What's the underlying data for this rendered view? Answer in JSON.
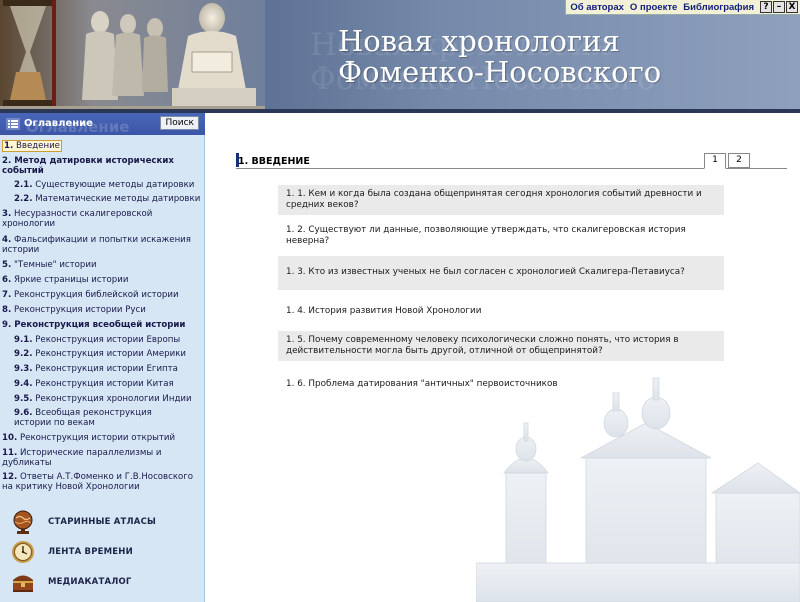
{
  "header": {
    "title_line1": "Новая хронология",
    "title_line2": "Фоменко-Носовского",
    "links": [
      "Об авторах",
      "О проекте",
      "Библиография"
    ],
    "window_buttons": [
      "?",
      "–",
      "X"
    ]
  },
  "sidebar": {
    "title": "Оглавление",
    "ghost_title": "Оглавление",
    "search_label": "Поиск",
    "toc": [
      {
        "num": "1.",
        "label": "Введение",
        "active": true
      },
      {
        "num": "2.",
        "label": "Метод датировки исторических событий",
        "bold": true
      },
      {
        "num": "2.1.",
        "label": "Существующие методы датировки",
        "sub": true
      },
      {
        "num": "2.2.",
        "label": "Математические методы датировки",
        "sub": true
      },
      {
        "num": "3.",
        "label": "Несуразности скалигеровской хронологии"
      },
      {
        "num": "4.",
        "label": "Фальсификации и попытки искажения истории"
      },
      {
        "num": "5.",
        "label": "\"Темные\" истории"
      },
      {
        "num": "6.",
        "label": "Яркие страницы истории"
      },
      {
        "num": "7.",
        "label": "Реконструкция библейской истории"
      },
      {
        "num": "8.",
        "label": "Реконструкция истории Руси"
      },
      {
        "num": "9.",
        "label": "Реконструкция всеобщей истории",
        "bold": true
      },
      {
        "num": "9.1.",
        "label": "Реконструкция истории Европы",
        "sub": true
      },
      {
        "num": "9.2.",
        "label": "Реконструкция истории Америки",
        "sub": true
      },
      {
        "num": "9.3.",
        "label": "Реконструкция истории Египта",
        "sub": true
      },
      {
        "num": "9.4.",
        "label": "Реконструкция истории Китая",
        "sub": true
      },
      {
        "num": "9.5.",
        "label": "Реконструкция хронологии Индии",
        "sub": true
      },
      {
        "num": "9.6.",
        "label": "Всеобщая реконструкция истории по векам",
        "sub": true
      },
      {
        "num": "10.",
        "label": "Реконструкция истории открытий"
      },
      {
        "num": "11.",
        "label": "Исторические параллелизмы и дубликаты"
      },
      {
        "num": "12.",
        "label": "Ответы А.Т.Фоменко и Г.В.Носовского на критику Новой Хронологии"
      }
    ],
    "bottom_links": [
      {
        "label": "СТАРИННЫЕ АТЛАСЫ",
        "icon": "globe-icon"
      },
      {
        "label": "ЛЕНТА ВРЕМЕНИ",
        "icon": "clock-icon"
      },
      {
        "label": "МЕДИАКАТАЛОГ",
        "icon": "chest-icon"
      }
    ]
  },
  "main": {
    "section_title": "1. ВВЕДЕНИЕ",
    "page_tabs": [
      "1",
      "2"
    ],
    "questions": [
      "1. 1. Кем и когда была создана общепринятая сегодня хронология событий древности и средних веков?",
      "1. 2. Существуют ли данные, позволяющие утверждать, что скалигеровская история неверна?",
      "1. 3. Кто из известных ученых не был согласен с хронологией Скалигера-Петавиуса?",
      "1. 4. История развития Новой Хронологии",
      "1. 5. Почему современному человеку психологически сложно понять, что история в действительности могла быть другой, отличной от общепринятой?",
      "1. 6. Проблема датирования \"античных\" первоисточников"
    ]
  },
  "colors": {
    "header_dark": "#3d4f72",
    "sidebar_bg": "#d6e6f5",
    "sidebar_header": "#4a66b8",
    "accent": "#1b2c78"
  }
}
